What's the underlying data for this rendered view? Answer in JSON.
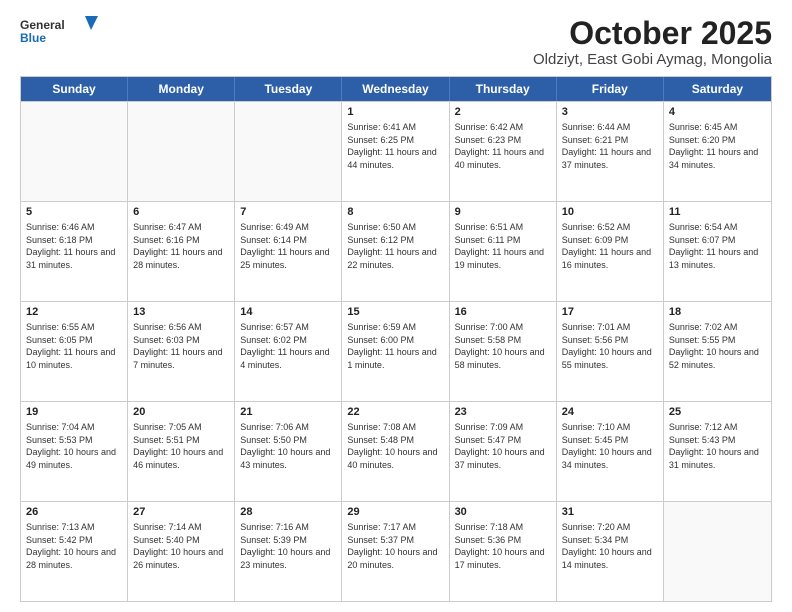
{
  "logo": {
    "line1": "General",
    "line2": "Blue"
  },
  "title": "October 2025",
  "subtitle": "Oldziyt, East Gobi Aymag, Mongolia",
  "days_of_week": [
    "Sunday",
    "Monday",
    "Tuesday",
    "Wednesday",
    "Thursday",
    "Friday",
    "Saturday"
  ],
  "weeks": [
    [
      {
        "day": "",
        "empty": true
      },
      {
        "day": "",
        "empty": true
      },
      {
        "day": "",
        "empty": true
      },
      {
        "day": "1",
        "sunrise": "6:41 AM",
        "sunset": "6:25 PM",
        "daylight": "11 hours and 44 minutes."
      },
      {
        "day": "2",
        "sunrise": "6:42 AM",
        "sunset": "6:23 PM",
        "daylight": "11 hours and 40 minutes."
      },
      {
        "day": "3",
        "sunrise": "6:44 AM",
        "sunset": "6:21 PM",
        "daylight": "11 hours and 37 minutes."
      },
      {
        "day": "4",
        "sunrise": "6:45 AM",
        "sunset": "6:20 PM",
        "daylight": "11 hours and 34 minutes."
      }
    ],
    [
      {
        "day": "5",
        "sunrise": "6:46 AM",
        "sunset": "6:18 PM",
        "daylight": "11 hours and 31 minutes."
      },
      {
        "day": "6",
        "sunrise": "6:47 AM",
        "sunset": "6:16 PM",
        "daylight": "11 hours and 28 minutes."
      },
      {
        "day": "7",
        "sunrise": "6:49 AM",
        "sunset": "6:14 PM",
        "daylight": "11 hours and 25 minutes."
      },
      {
        "day": "8",
        "sunrise": "6:50 AM",
        "sunset": "6:12 PM",
        "daylight": "11 hours and 22 minutes."
      },
      {
        "day": "9",
        "sunrise": "6:51 AM",
        "sunset": "6:11 PM",
        "daylight": "11 hours and 19 minutes."
      },
      {
        "day": "10",
        "sunrise": "6:52 AM",
        "sunset": "6:09 PM",
        "daylight": "11 hours and 16 minutes."
      },
      {
        "day": "11",
        "sunrise": "6:54 AM",
        "sunset": "6:07 PM",
        "daylight": "11 hours and 13 minutes."
      }
    ],
    [
      {
        "day": "12",
        "sunrise": "6:55 AM",
        "sunset": "6:05 PM",
        "daylight": "11 hours and 10 minutes."
      },
      {
        "day": "13",
        "sunrise": "6:56 AM",
        "sunset": "6:03 PM",
        "daylight": "11 hours and 7 minutes."
      },
      {
        "day": "14",
        "sunrise": "6:57 AM",
        "sunset": "6:02 PM",
        "daylight": "11 hours and 4 minutes."
      },
      {
        "day": "15",
        "sunrise": "6:59 AM",
        "sunset": "6:00 PM",
        "daylight": "11 hours and 1 minute."
      },
      {
        "day": "16",
        "sunrise": "7:00 AM",
        "sunset": "5:58 PM",
        "daylight": "10 hours and 58 minutes."
      },
      {
        "day": "17",
        "sunrise": "7:01 AM",
        "sunset": "5:56 PM",
        "daylight": "10 hours and 55 minutes."
      },
      {
        "day": "18",
        "sunrise": "7:02 AM",
        "sunset": "5:55 PM",
        "daylight": "10 hours and 52 minutes."
      }
    ],
    [
      {
        "day": "19",
        "sunrise": "7:04 AM",
        "sunset": "5:53 PM",
        "daylight": "10 hours and 49 minutes."
      },
      {
        "day": "20",
        "sunrise": "7:05 AM",
        "sunset": "5:51 PM",
        "daylight": "10 hours and 46 minutes."
      },
      {
        "day": "21",
        "sunrise": "7:06 AM",
        "sunset": "5:50 PM",
        "daylight": "10 hours and 43 minutes."
      },
      {
        "day": "22",
        "sunrise": "7:08 AM",
        "sunset": "5:48 PM",
        "daylight": "10 hours and 40 minutes."
      },
      {
        "day": "23",
        "sunrise": "7:09 AM",
        "sunset": "5:47 PM",
        "daylight": "10 hours and 37 minutes."
      },
      {
        "day": "24",
        "sunrise": "7:10 AM",
        "sunset": "5:45 PM",
        "daylight": "10 hours and 34 minutes."
      },
      {
        "day": "25",
        "sunrise": "7:12 AM",
        "sunset": "5:43 PM",
        "daylight": "10 hours and 31 minutes."
      }
    ],
    [
      {
        "day": "26",
        "sunrise": "7:13 AM",
        "sunset": "5:42 PM",
        "daylight": "10 hours and 28 minutes."
      },
      {
        "day": "27",
        "sunrise": "7:14 AM",
        "sunset": "5:40 PM",
        "daylight": "10 hours and 26 minutes."
      },
      {
        "day": "28",
        "sunrise": "7:16 AM",
        "sunset": "5:39 PM",
        "daylight": "10 hours and 23 minutes."
      },
      {
        "day": "29",
        "sunrise": "7:17 AM",
        "sunset": "5:37 PM",
        "daylight": "10 hours and 20 minutes."
      },
      {
        "day": "30",
        "sunrise": "7:18 AM",
        "sunset": "5:36 PM",
        "daylight": "10 hours and 17 minutes."
      },
      {
        "day": "31",
        "sunrise": "7:20 AM",
        "sunset": "5:34 PM",
        "daylight": "10 hours and 14 minutes."
      },
      {
        "day": "",
        "empty": true
      }
    ]
  ]
}
